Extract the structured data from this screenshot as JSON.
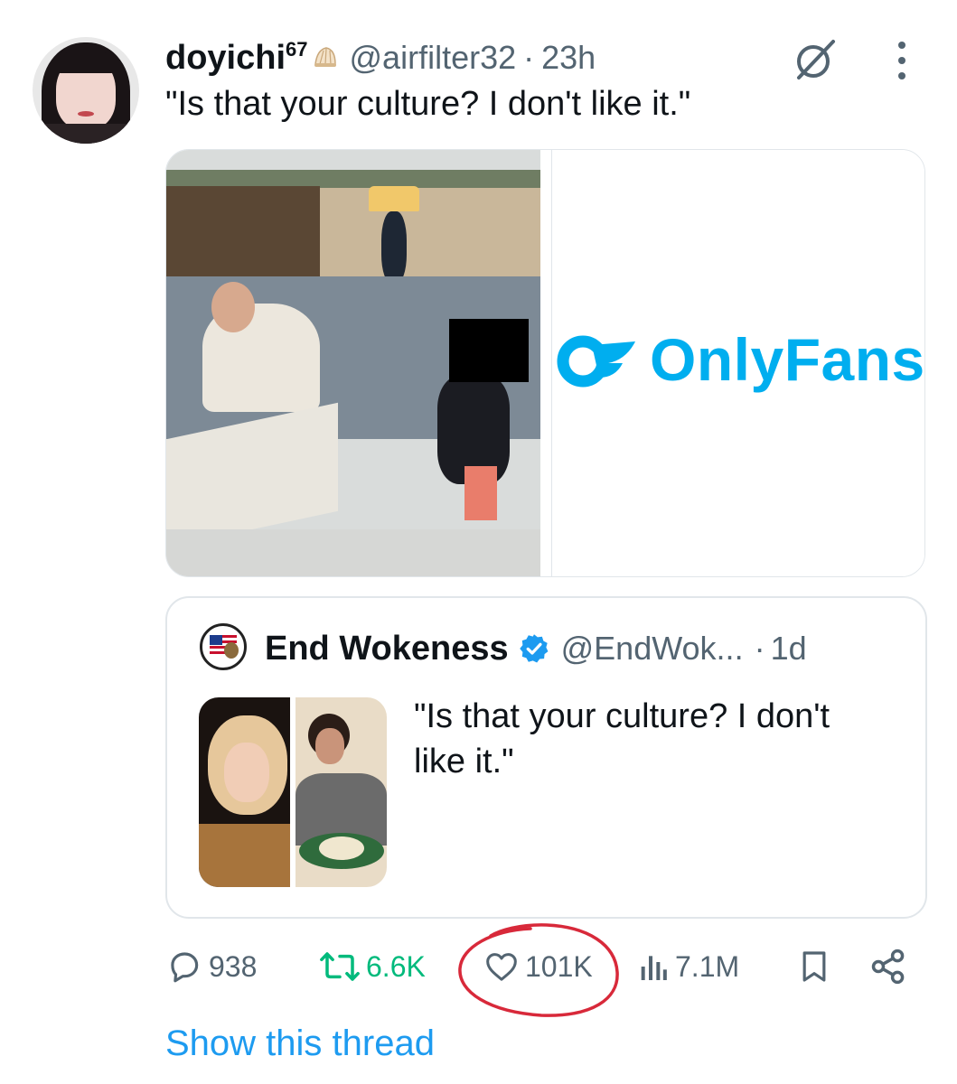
{
  "tweet": {
    "author": {
      "name": "doyichi",
      "name_sup": "67",
      "handle": "@airfilter32",
      "separator": "·",
      "time": "23h"
    },
    "text": "\"Is that your culture? I don't like it.\"",
    "media": {
      "right_panel_text": "OnlyFans"
    }
  },
  "quoted": {
    "author": {
      "name": "End Wokeness",
      "handle": "@EndWok...",
      "separator": "·",
      "time": "1d",
      "verified": true
    },
    "text": "\"Is that your culture? I don't like it.\""
  },
  "actions": {
    "replies": "938",
    "retweets": "6.6K",
    "likes": "101K",
    "views": "7.1M"
  },
  "footer": {
    "show_thread": "Show this thread"
  },
  "colors": {
    "link": "#1d9bf0",
    "retweet": "#00ba7c",
    "annotation_circle": "#d8293a",
    "onlyfans": "#00aeef",
    "secondary_text": "#536471"
  },
  "icons": [
    "shell-icon",
    "grok-icon",
    "more-icon",
    "verified-icon",
    "reply-icon",
    "retweet-icon",
    "like-icon",
    "views-icon",
    "bookmark-icon",
    "share-icon",
    "onlyfans-logo-icon"
  ]
}
